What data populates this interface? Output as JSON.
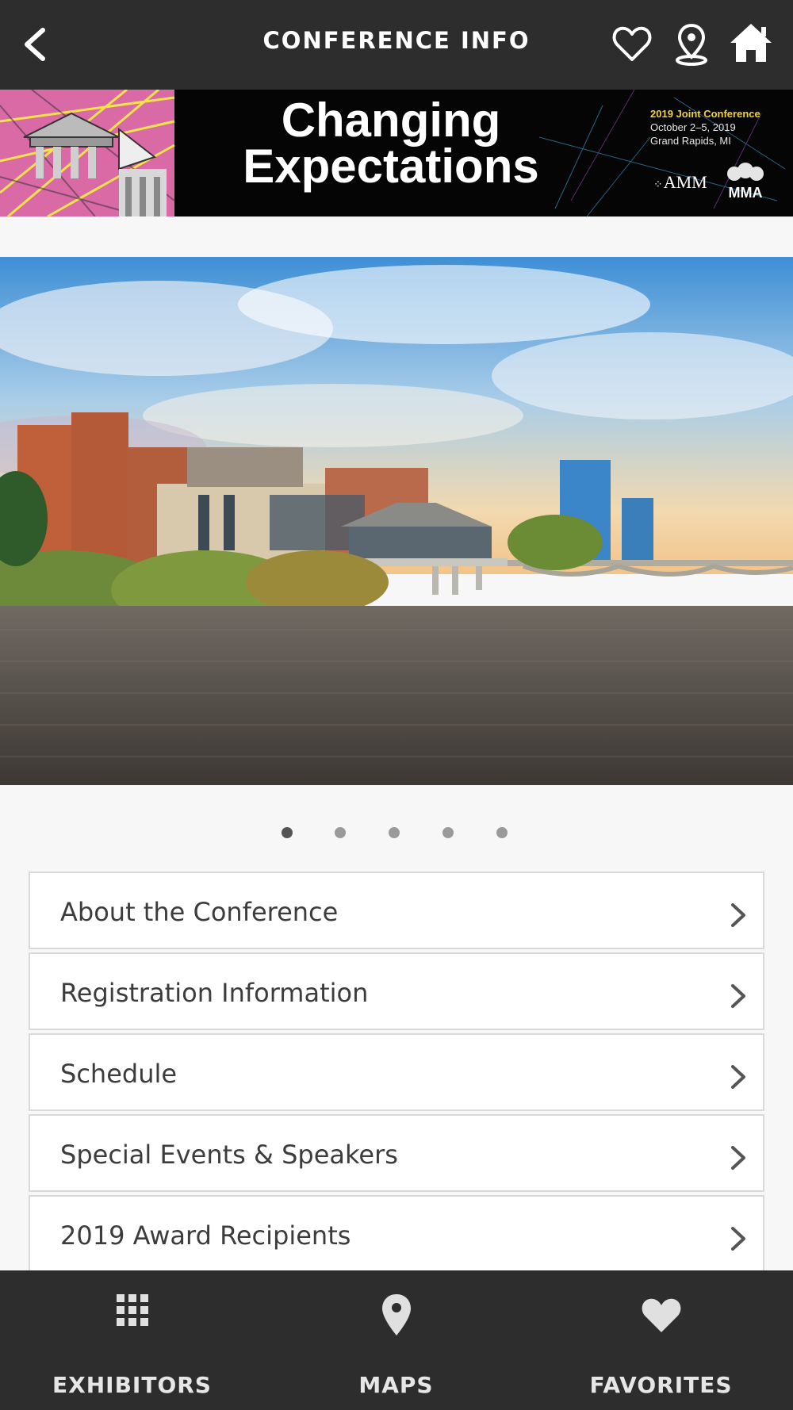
{
  "header": {
    "title": "CONFERENCE INFO",
    "back_icon": "chevron-left-icon",
    "favorites_icon": "heart-outline-icon",
    "location_icon": "map-pin-icon",
    "home_icon": "home-icon"
  },
  "banner": {
    "headline_line1": "Changing",
    "headline_line2": "Expectations",
    "conference_name": "2019 Joint Conference",
    "dates": "October 2–5, 2019",
    "location": "Grand Rapids, MI",
    "logo_left": "AMM",
    "logo_right": "MMA"
  },
  "carousel": {
    "slide_count": 5,
    "active_index": 0
  },
  "menu": {
    "items": [
      {
        "label": "About the Conference"
      },
      {
        "label": "Registration Information"
      },
      {
        "label": "Schedule"
      },
      {
        "label": "Special Events & Speakers"
      },
      {
        "label": "2019 Award Recipients"
      }
    ]
  },
  "bottom_nav": {
    "items": [
      {
        "label": "EXHIBITORS",
        "icon": "grid-icon"
      },
      {
        "label": "MAPS",
        "icon": "map-pin-icon"
      },
      {
        "label": "FAVORITES",
        "icon": "heart-icon"
      }
    ]
  },
  "colors": {
    "bar_background": "#2d2d2d",
    "page_background": "#f7f7f7",
    "accent_yellow": "#f2d23a"
  }
}
